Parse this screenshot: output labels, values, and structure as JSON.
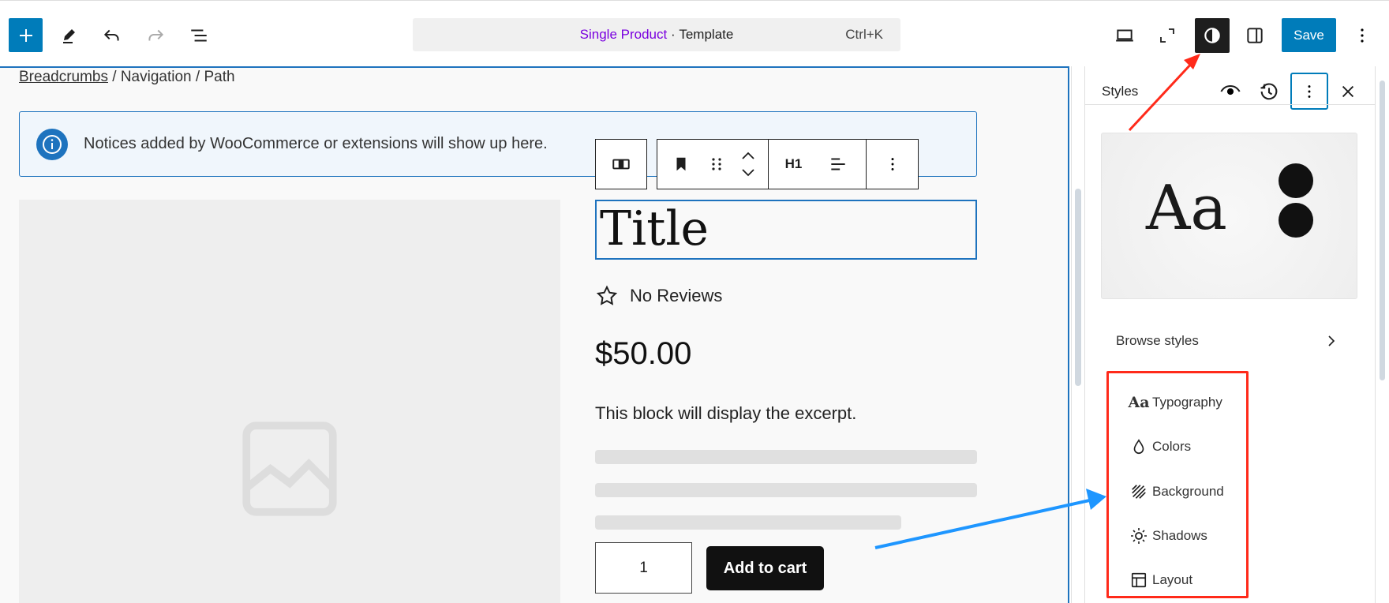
{
  "topbar": {
    "command_title": "Single Product",
    "command_sep": " · ",
    "command_type": "Template",
    "shortcut": "Ctrl+K",
    "save_label": "Save"
  },
  "canvas": {
    "breadcrumb_link": "Breadcrumbs",
    "breadcrumb_rest": " / Navigation / Path",
    "notice": "Notices added by WooCommerce or extensions will show up here.",
    "block_toolbar": {
      "heading_level": "H1"
    },
    "title": "Title",
    "reviews": "No Reviews",
    "price": "$50.00",
    "excerpt": "This block will display the excerpt.",
    "quantity": "1",
    "add_to_cart": "Add to cart"
  },
  "sidebar": {
    "title": "Styles",
    "preview_text": "Aa",
    "browse_styles": "Browse styles",
    "items": [
      {
        "label": "Typography",
        "icon": "typography-icon"
      },
      {
        "label": "Colors",
        "icon": "droplet-icon"
      },
      {
        "label": "Background",
        "icon": "background-icon"
      },
      {
        "label": "Shadows",
        "icon": "sun-icon"
      },
      {
        "label": "Layout",
        "icon": "layout-icon"
      }
    ]
  },
  "colors": {
    "accent": "#007cba",
    "command_title": "#7a00df",
    "annotation_red": "#ff2a1a",
    "annotation_blue": "#1e96ff"
  }
}
